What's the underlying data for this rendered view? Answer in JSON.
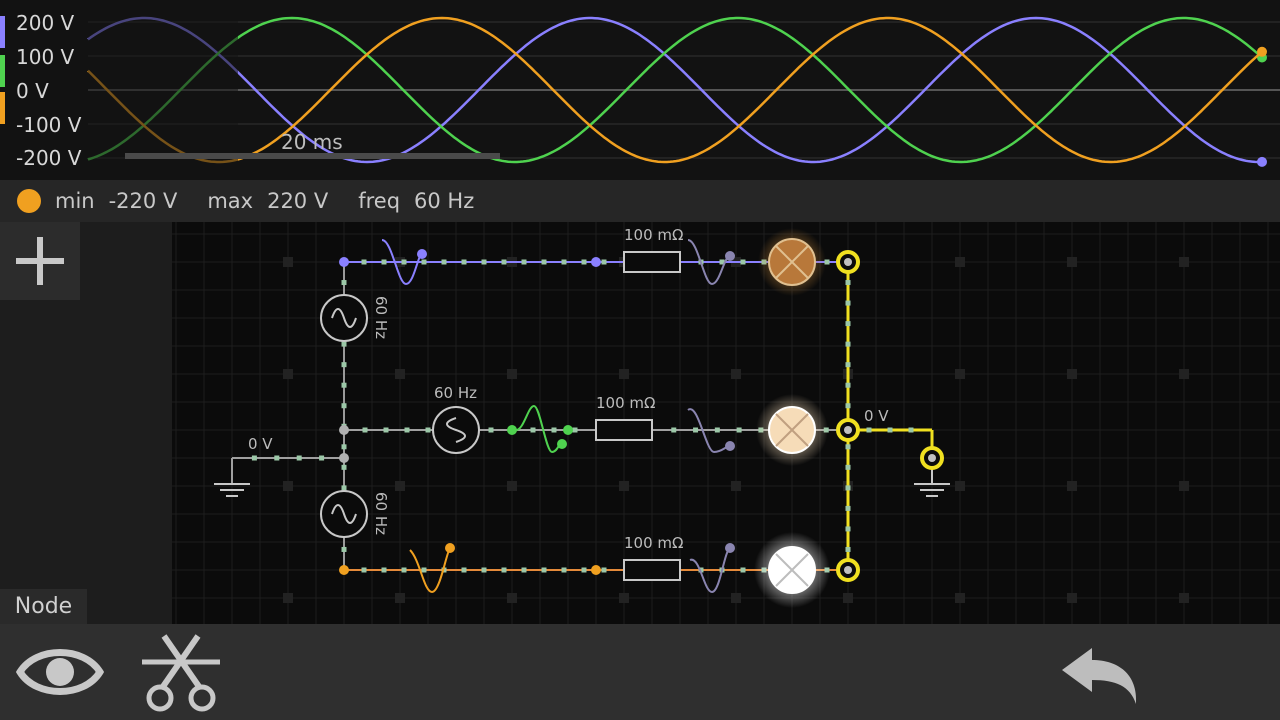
{
  "scope": {
    "y_ticks": [
      "200 V",
      "100 V",
      "0 V",
      "-100 V",
      "-200 V"
    ],
    "timebar_label": "20 ms",
    "traces": [
      {
        "color": "#8a80ff",
        "icon": "trace-purple"
      },
      {
        "color": "#4fd24f",
        "icon": "trace-green"
      },
      {
        "color": "#f0a020",
        "icon": "trace-orange"
      }
    ]
  },
  "info": {
    "dot_color": "#f0a020",
    "min_label": "min",
    "min_value": "-220 V",
    "max_label": "max",
    "max_value": "220 V",
    "freq_label": "freq",
    "freq_value": "60 Hz"
  },
  "sidebar": {
    "add_icon": "plus-icon",
    "node_tab": "Node"
  },
  "circuit": {
    "source_top_label": "60 Hz",
    "source_mid_label": "60 Hz",
    "source_bottom_label": "60 Hz",
    "resistor_top_label": "100 mΩ",
    "resistor_mid_label": "100 mΩ",
    "resistor_bottom_label": "100 mΩ",
    "ground_left_label": "0 V",
    "ground_right_label": "0 V"
  },
  "toolbar": {
    "view_icon": "eye-icon",
    "cut_icon": "scissors-icon",
    "undo_icon": "undo-icon"
  }
}
